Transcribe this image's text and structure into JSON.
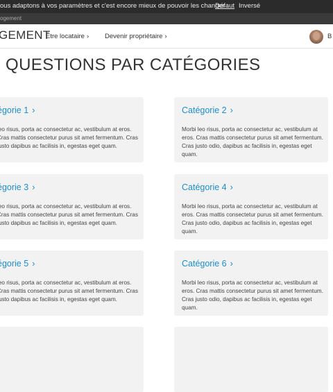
{
  "banner": {
    "message": "ous adaptons à vos paramètres et c'est encore mieux de pouvoir les changer :",
    "option_default": "Défaut",
    "option_inverse": "Inversé"
  },
  "subbar": {
    "text": "ogement"
  },
  "nav": {
    "brand": "GEMENT",
    "links": [
      "Être locataire",
      "Devenir propriétaire"
    ],
    "chevron": "›",
    "user_initial": "B"
  },
  "page": {
    "title": "QUESTIONS PAR CATÉGORIES"
  },
  "cards": [
    {
      "title": "égorie 1",
      "text": "leo risus, porta ac consectetur ac, vestibulum at eros. Cras mattis consectetur purus sit amet fermentum. Cras justo dapibus ac facilisis in, egestas eget quam."
    },
    {
      "title": "Catégorie 2",
      "text": "Morbi leo risus, porta ac consectetur ac, vestibulum at eros. Cras mattis consectetur purus sit amet fermentum. Cras justo odio, dapibus ac facilisis in, egestas eget quam."
    },
    {
      "title": "égorie 3",
      "text": "leo risus, porta ac consectetur ac, vestibulum at eros. Cras mattis consectetur purus sit amet fermentum. Cras justo dapibus ac facilisis in, egestas eget quam."
    },
    {
      "title": "Catégorie 4",
      "text": "Morbi leo risus, porta ac consectetur ac, vestibulum at eros. Cras mattis consectetur purus sit amet fermentum. Cras justo odio, dapibus ac facilisis in, egestas eget quam."
    },
    {
      "title": "égorie 5",
      "text": "leo risus, porta ac consectetur ac, vestibulum at eros. Cras mattis consectetur purus sit amet fermentum. Cras justo dapibus ac facilisis in, egestas eget quam."
    },
    {
      "title": "Catégorie 6",
      "text": "Morbi leo risus, porta ac consectetur ac, vestibulum at eros. Cras mattis consectetur purus sit amet fermentum. Cras justo odio, dapibus ac facilisis in, egestas eget quam."
    }
  ],
  "colors": {
    "accent": "#1e8ec6",
    "card_bg": "#f2f2f2",
    "banner_bg": "#2b2b2b"
  }
}
